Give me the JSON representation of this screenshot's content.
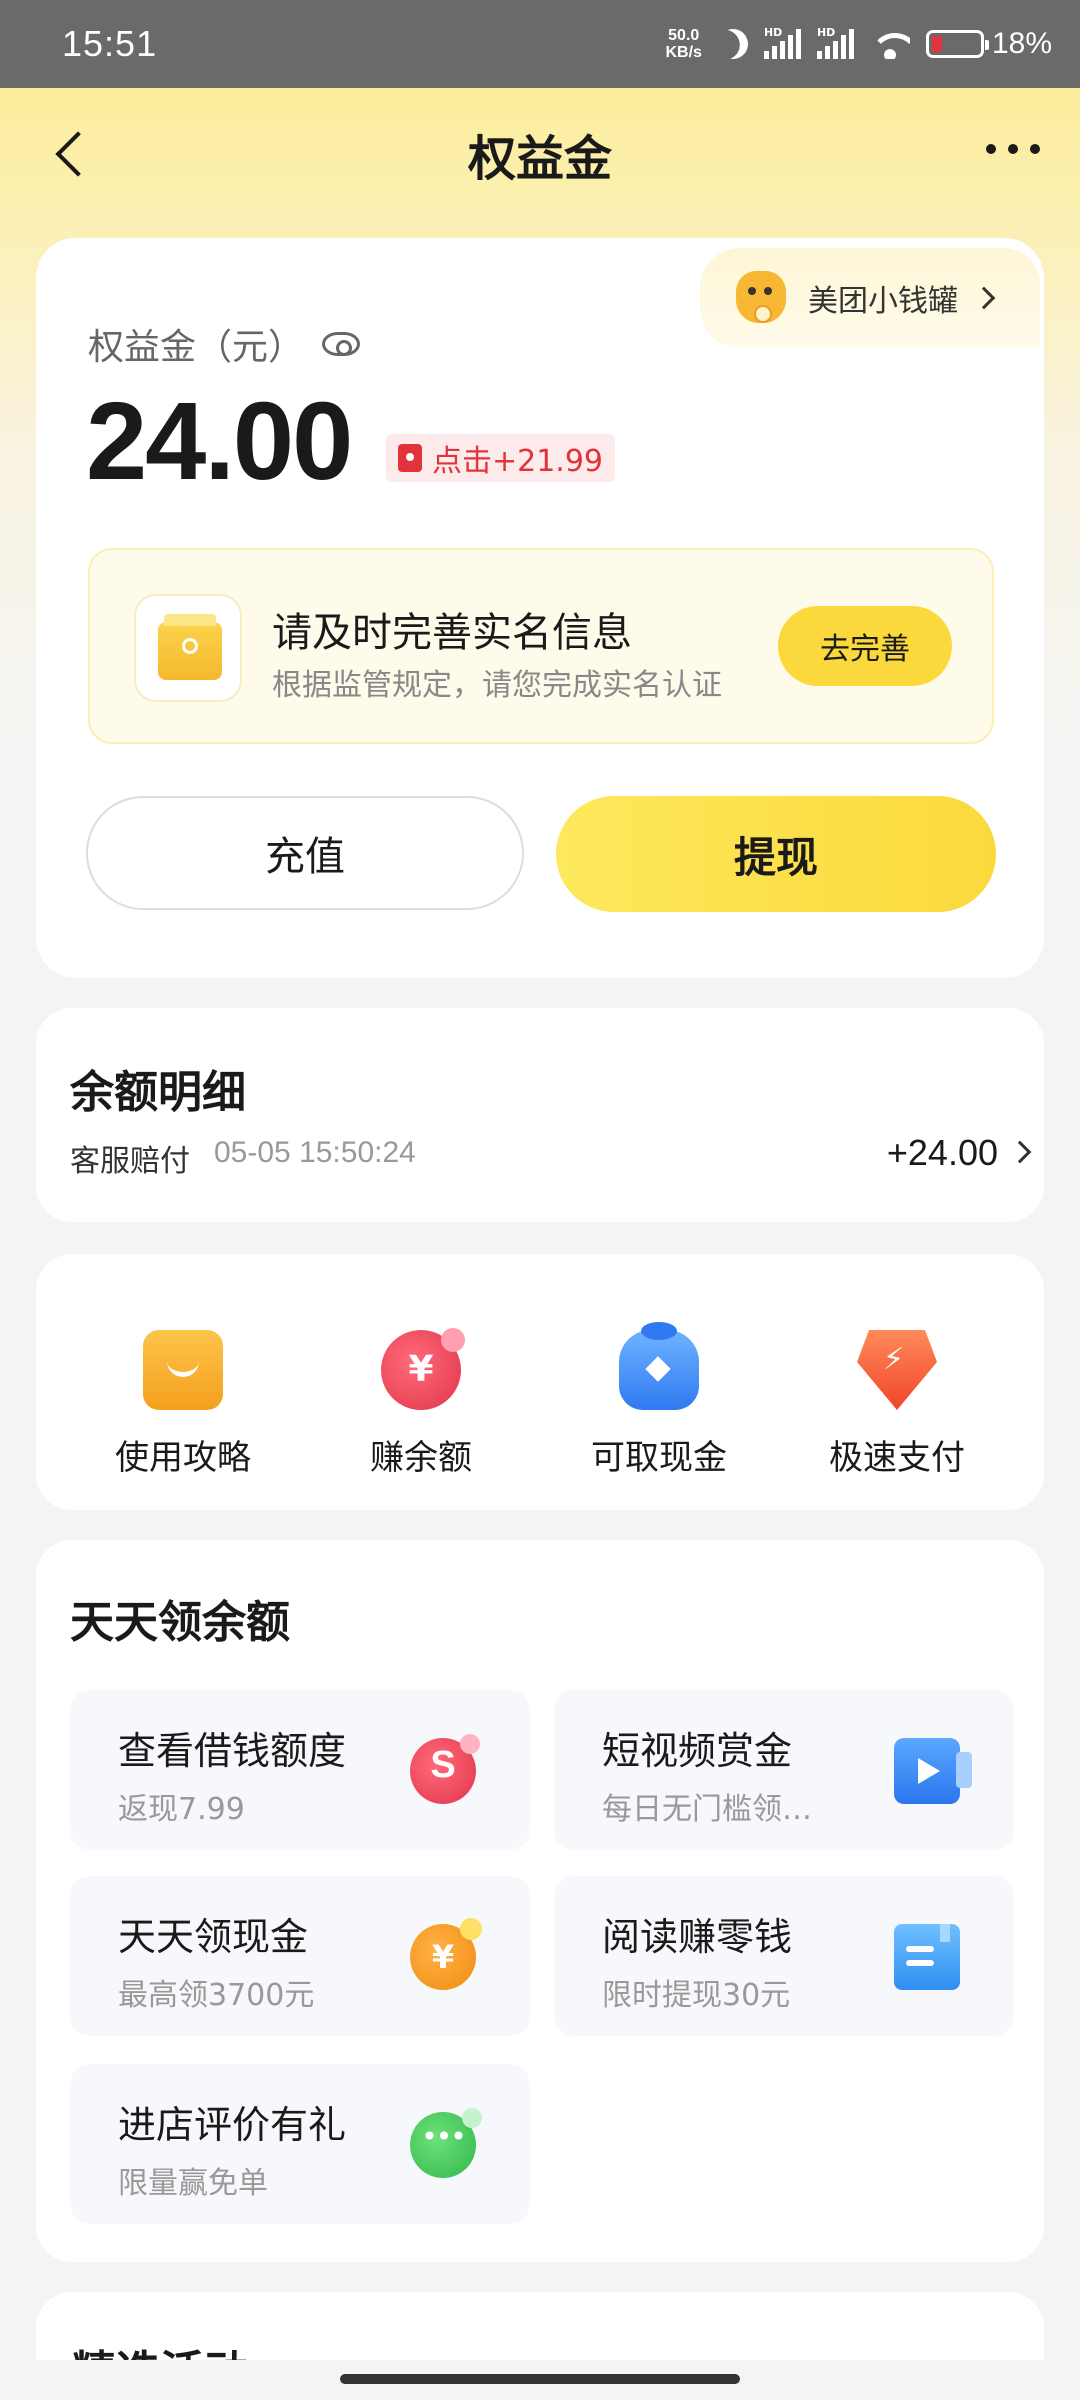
{
  "status_bar": {
    "time": "15:51",
    "net_speed_value": "50.0",
    "net_speed_unit": "KB/s",
    "signal_1": "HD",
    "signal_2": "HD",
    "battery": "18%"
  },
  "header": {
    "title": "权益金"
  },
  "piggy_bank": {
    "label": "美团小钱罐"
  },
  "balance": {
    "label": "权益金（元）",
    "amount": "24.00",
    "bonus": "点击+21.99"
  },
  "realname": {
    "title": "请及时完善实名信息",
    "subtitle": "根据监管规定，请您完成实名认证",
    "button": "去完善"
  },
  "actions": {
    "recharge": "充值",
    "withdraw": "提现"
  },
  "balance_detail": {
    "title": "余额明细",
    "entries": [
      {
        "label": "客服赔付",
        "time": "05-05 15:50:24",
        "amount": "+24.00"
      }
    ]
  },
  "quick_actions": [
    {
      "label": "使用攻略",
      "icon": "guide-icon",
      "glyph": ""
    },
    {
      "label": "赚余额",
      "icon": "earn-balance-icon",
      "glyph": "¥"
    },
    {
      "label": "可取现金",
      "icon": "cash-bag-icon",
      "glyph": ""
    },
    {
      "label": "极速支付",
      "icon": "fast-pay-icon",
      "glyph": ""
    }
  ],
  "daily": {
    "title": "天天领余额",
    "tasks": [
      {
        "title": "查看借钱额度",
        "subtitle": "返现7.99",
        "icon": "loan-icon"
      },
      {
        "title": "短视频赏金",
        "subtitle": "每日无门槛领…",
        "icon": "video-icon"
      },
      {
        "title": "天天领现金",
        "subtitle": "最高领3700元",
        "icon": "coin-icon",
        "glyph": "¥"
      },
      {
        "title": "阅读赚零钱",
        "subtitle": "限时提现30元",
        "icon": "book-icon"
      },
      {
        "title": "进店评价有礼",
        "subtitle": "限量赢免单",
        "icon": "chat-icon"
      }
    ]
  },
  "featured": {
    "title": "精选活动"
  },
  "colors": {
    "brand_yellow": "#fbd93c",
    "accent_red": "#e0343a"
  }
}
